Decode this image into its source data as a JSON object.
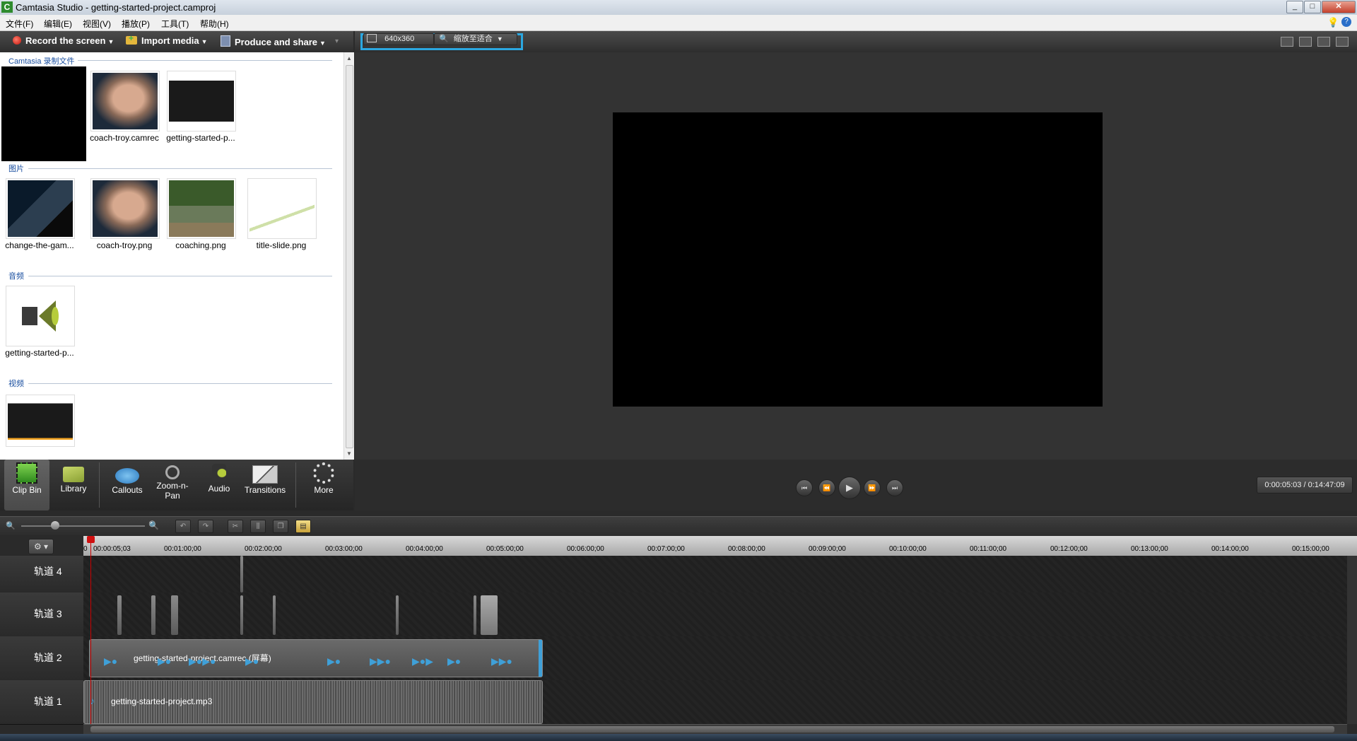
{
  "window": {
    "title": "Camtasia Studio - getting-started-project.camproj",
    "app_icon": "C"
  },
  "menu": [
    "文件(F)",
    "编辑(E)",
    "视图(V)",
    "播放(P)",
    "工具(T)",
    "帮助(H)"
  ],
  "toolbar": {
    "record": "Record the screen",
    "import": "Import media",
    "produce": "Produce and share"
  },
  "clip_bin": {
    "sections": [
      {
        "title": "Camtasia 录制文件",
        "items": [
          "",
          "coach-troy.camrec",
          "getting-started-p..."
        ]
      },
      {
        "title": "图片",
        "items": [
          "change-the-gam...",
          "coach-troy.png",
          "coaching.png",
          "title-slide.png"
        ]
      },
      {
        "title": "音频",
        "items": [
          "getting-started-p..."
        ]
      },
      {
        "title": "视频",
        "items": [
          ""
        ]
      }
    ]
  },
  "tool_tabs": [
    "Clip Bin",
    "Library",
    "Callouts",
    "Zoom-n-Pan",
    "Audio",
    "Transitions",
    "More"
  ],
  "preview": {
    "dimensions": "640x360",
    "zoom": "缩放至适合",
    "timecode": "0:00:05:03 / 0:14:47:09",
    "progress_fraction": 0.006
  },
  "timeline": {
    "ruler_labels": [
      "0",
      "00:00:05;03",
      "00:01:00;00",
      "00:02:00;00",
      "00:03:00;00",
      "00:04:00;00",
      "00:05:00;00",
      "00:06:00;00",
      "00:07:00;00",
      "00:08:00;00",
      "00:09:00;00",
      "00:10:00;00",
      "00:11:00;00",
      "00:12:00;00",
      "00:13:00;00",
      "00:14:00;00",
      "00:15:00;00"
    ],
    "tracks": [
      {
        "label": "轨道 4",
        "clip": ""
      },
      {
        "label": "轨道 3",
        "clip": ""
      },
      {
        "label": "轨道 2",
        "clip": "getting-started-project.camrec (屏幕)"
      },
      {
        "label": "轨道 1",
        "clip": "getting-started-project.mp3"
      }
    ]
  },
  "colors": {
    "highlight": "#2ba7e0",
    "record": "#d0201a",
    "playhead": "#cc0000"
  }
}
